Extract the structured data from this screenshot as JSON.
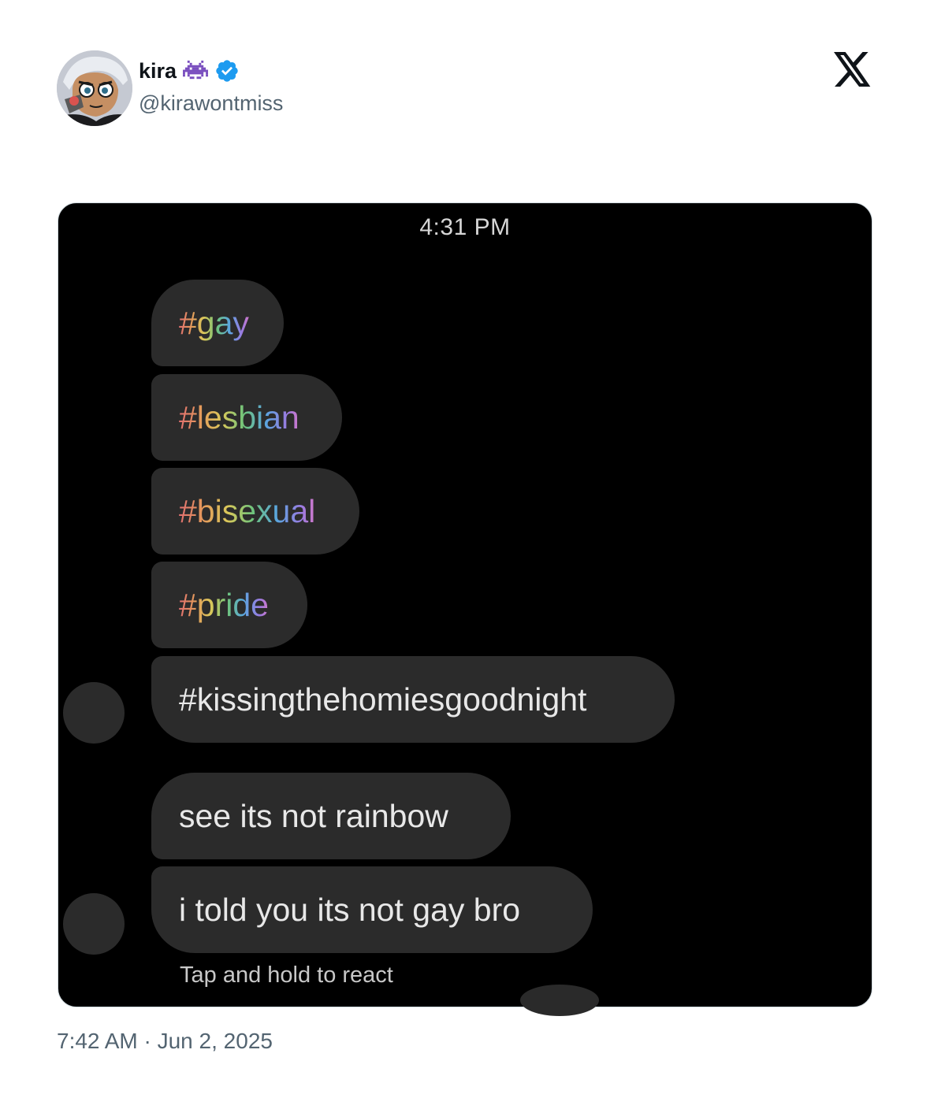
{
  "tweet": {
    "author": {
      "display_name": "kira",
      "handle": "@kirawontmiss",
      "emoji_icon": "space-invader-icon",
      "verified": true
    },
    "platform_icon": "x-logo-icon",
    "timestamp": "7:42 AM · Jun 2, 2025"
  },
  "screenshot": {
    "time": "4:31 PM",
    "messages": [
      {
        "text": "#gay",
        "style": "rainbow"
      },
      {
        "text": "#lesbian",
        "style": "rainbow"
      },
      {
        "text": "#bisexual",
        "style": "rainbow"
      },
      {
        "text": "#pride",
        "style": "rainbow"
      },
      {
        "text": "#kissingthehomiesgoodnight",
        "style": "plain"
      },
      {
        "text": "see its not rainbow",
        "style": "plain"
      },
      {
        "text": "i told you its not gay bro",
        "style": "plain"
      }
    ],
    "hint": "Tap and hold to react"
  },
  "colors": {
    "verified_blue": "#1d9bf0",
    "bubble_bg": "#2b2b2b",
    "media_bg": "#000000",
    "secondary_text": "#536471"
  }
}
